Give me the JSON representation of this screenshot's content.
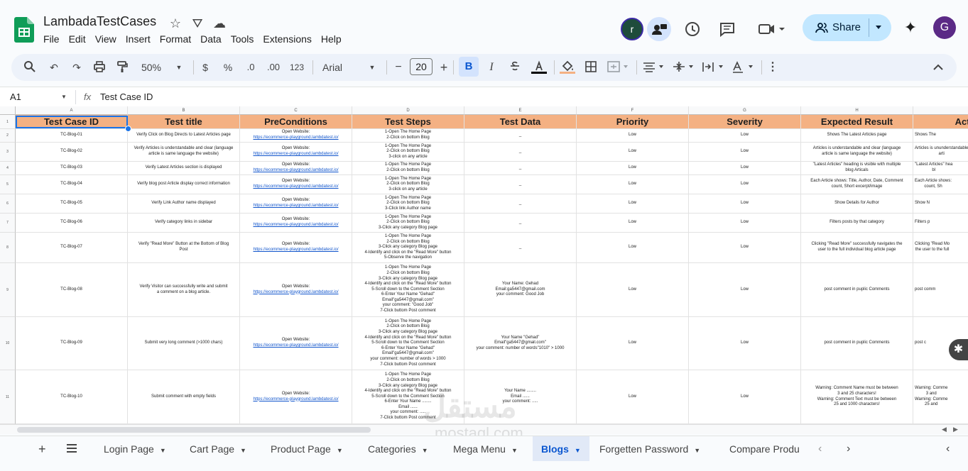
{
  "app": {
    "title": "LambadaTestCases",
    "menu": [
      "File",
      "Edit",
      "View",
      "Insert",
      "Format",
      "Data",
      "Tools",
      "Extensions",
      "Help"
    ],
    "share_label": "Share",
    "avatar_r": "r",
    "avatar_g": "G"
  },
  "toolbar": {
    "zoom": "50%",
    "currency": "$",
    "percent": "%",
    "dec_less": ".0",
    "dec_more": ".00",
    "num_format": "123",
    "font": "Arial",
    "font_size": "20",
    "minus": "−",
    "plus": "+",
    "bold": "B",
    "italic": "I"
  },
  "formula_bar": {
    "cell_ref": "A1",
    "fx": "fx",
    "content": "Test Case ID"
  },
  "sheet": {
    "col_letters": [
      "A",
      "B",
      "C",
      "D",
      "E",
      "F",
      "G",
      "H",
      "I"
    ],
    "headers": [
      "Test Case ID",
      "Test title",
      "PreConditions",
      "Test Steps",
      "Test Data",
      "Priority",
      "Severity",
      "Expected Result",
      "Actual"
    ],
    "row_numbers": [
      "1",
      "2",
      "3",
      "4",
      "5",
      "6",
      "7",
      "8",
      "9",
      "10",
      "11"
    ],
    "rows": [
      [
        "TC-Blog-01",
        "Verify Click on Blog Directs to Latest Articles page",
        "Open Website:",
        "https://ecommerce-playground.lambdatest.io/",
        "1-Open The Home Page\n2-Click on bottom Blog",
        "_",
        "Low",
        "Low",
        "Shows The Latest Articles page",
        "Shows The"
      ],
      [
        "TC-Blog-02",
        "Verify Articles is understandable and clear (language\narticle is  same language the website)",
        "Open Website:",
        "https://ecommerce-playground.lambdatest.io/",
        "1-Open The Home Page\n2-Click on bottom Blog\n3-click on any article",
        "_",
        "Low",
        "Low",
        "Articles is understandable and clear (language\narticle is  same language the website)",
        "Articles is ununderstandable\narti"
      ],
      [
        "TC-Blog-03",
        "Verify Latest Articles section is displayed",
        "Open Website:",
        "https://ecommerce-playground.lambdatest.io/",
        "1-Open The Home Page\n2-Click on bottom Blog",
        "_",
        "Low",
        "Low",
        "\"Latest Articles\" heading is visible with multiple\nblog Articals",
        "\"Latest Articles\" hea\nbl"
      ],
      [
        "TC-Blog-04",
        "Verify blog post Article display correct information",
        "Open Website:",
        "https://ecommerce-playground.lambdatest.io/",
        "1-Open The Home Page\n2-Click on bottom Blog\n3-click on any article",
        "_",
        "Low",
        "Low",
        "Each Article shows: Title, Author, Date, Comment\ncount, Short excerpt/image",
        "Each Article shows:\ncount, Sh"
      ],
      [
        "TC-Blog-05",
        "Verify Link Author name displayed",
        "Open Website:",
        "https://ecommerce-playground.lambdatest.io/",
        "1-Open The Home Page\n2-Click on bottom Blog\n3-Click link Author name",
        "_",
        "Low",
        "Low",
        "Show Details for Author",
        "Show N"
      ],
      [
        "TC-Blog-06",
        "Verify category links in sidebar",
        "Open Website:",
        "https://ecommerce-playground.lambdatest.io/",
        "1-Open The Home Page\n2-Click on bottom Blog\n3-Click any category Blog page",
        "_",
        "Low",
        "Low",
        "Filters posts by that category",
        "Filters p"
      ],
      [
        "TC-Blog-07",
        "Verify \"Read More\" Button at the Bottom of Blog\nPost",
        "Open Website:",
        "https://ecommerce-playground.lambdatest.io/",
        "1-Open The Home Page\n2-Click on bottom Blog\n3-Click any category Blog page\n4-Identify and click on the \"Read More\" button\n5-Observe the navigation",
        "_",
        "Low",
        "Low",
        "Clicking \"Read More\" successfully navigates the\nuser to the full individual blog article page",
        "Clicking \"Read Mo\nthe user to the full"
      ],
      [
        "TC-Blog-08",
        "Verify Visitor can successfully write and submit\na comment on a blog article.",
        "Open Website:",
        "https://ecommerce-playground.lambdatest.io/",
        "1-Open The Home Page\n2-Click on bottom Blog\n3-Click any category Blog page\n4-Identify and click on the \"Read More\" button\n5-Scroll down to the Comment Section\n6-Enter Your Name \"Gehad\"\nEmail\"ga5447@gmail.com\"\nyour comment: \"Good Job\"\n7-Click buttom Post comment",
        "Your Name: Gehad\nEmail:ga5447@gmail.com\nyour comment: Good Job",
        "Low",
        "Low",
        "post comment in puplic Comments",
        "post comm"
      ],
      [
        "TC-Blog-09",
        "Submit very long comment (>1000 chars)",
        "Open Website:",
        "https://ecommerce-playground.lambdatest.io/",
        "1-Open The Home Page\n2-Click on bottom Blog\n3-Click any category Blog page\n4-Identify and click on the \"Read More\" button\n5-Scroll down to the Comment Section\n6-Enter Your Name \"Gehad\"\nEmail\"ga5447@gmail.com\"\nyour comment: number of words > 1000\n7-Click buttom Post comment",
        "Your Name \"Gehad\"\nEmail\"ga5447@gmail.com\"\nyour comment: number of words\"1010\" > 1000",
        "Low",
        "Low",
        "post comment in puplic Comments",
        "post c"
      ],
      [
        "TC-Blog-10",
        "Submit comment with empty fields",
        "Open Website:",
        "https://ecommerce-playground.lambdatest.io/",
        "1-Open The Home Page\n2-Click on bottom Blog\n3-Click any category Blog page\n4-Identify and click on the \"Read More\" button\n5-Scroll down to the Comment Section\n6-Enter Your Name ........\nEmail ......\nyour comment: .....\n7-Click buttom Post comment",
        "Your Name ........\nEmail ......\nyour comment: .....",
        "Low",
        "Low",
        "Warning: Comment Name must be between\n3 and 25 characters!\nWarning: Comment Text must be between\n25 and 1000 characters!",
        "Warning: Comme\n3 and\nWarning: Comme\n25 and"
      ]
    ],
    "partial_row": "1-Open The Home Page"
  },
  "tabs": [
    "Login Page",
    "Cart Page",
    "Product Page",
    "Categories",
    "Mega Menu",
    "Blogs",
    "Forgetten Password",
    "Compare Produ"
  ],
  "active_tab": "Blogs",
  "watermark": "مستقل",
  "watermark_sub": "mostaql.com",
  "colors": {
    "header_fill": "#f4b183",
    "accent": "#0b57d0",
    "share_bg": "#c2e7ff"
  }
}
